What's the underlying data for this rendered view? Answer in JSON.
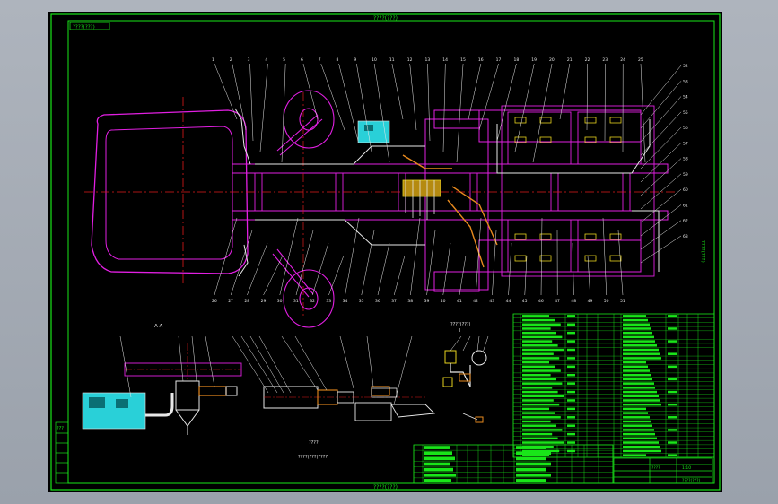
{
  "drawing": {
    "top_header": "????(???)",
    "bottom_footer": "????(???)",
    "right_side_label": "????(???)",
    "top_left_tag": "????(???)",
    "side_view_label": "A-A",
    "detail_view_label": "????(???)",
    "detail_view_label_sub": "I",
    "lower_label": "????",
    "lower_note": "????(???)????",
    "left_tag": "???"
  },
  "top_callouts": [
    "1",
    "2",
    "3",
    "4",
    "5",
    "6",
    "7",
    "8",
    "9",
    "10",
    "11",
    "12",
    "13",
    "14",
    "15",
    "16",
    "17",
    "18",
    "19",
    "20",
    "21",
    "22",
    "23",
    "24",
    "25"
  ],
  "bottom_callouts": [
    "26",
    "27",
    "28",
    "29",
    "30",
    "31",
    "32",
    "33",
    "34",
    "35",
    "36",
    "37",
    "38",
    "39",
    "40",
    "41",
    "42",
    "43",
    "44",
    "45",
    "46",
    "47",
    "48",
    "49",
    "50",
    "51"
  ],
  "right_callouts": [
    "52",
    "53",
    "54",
    "55",
    "56",
    "57",
    "58",
    "59",
    "60",
    "61",
    "62",
    "63"
  ],
  "title_block": {
    "designation": "????",
    "scale": "1:10",
    "sheet": "????(???)"
  },
  "colors": {
    "frame": "#19e619",
    "parts_table": "#19e619",
    "body": "#e21fe2",
    "centerline": "#e01b1b",
    "white": "#e8e8e8",
    "cyan": "#29d0d8",
    "yellow": "#e6d21e",
    "orange": "#e88a1e"
  }
}
